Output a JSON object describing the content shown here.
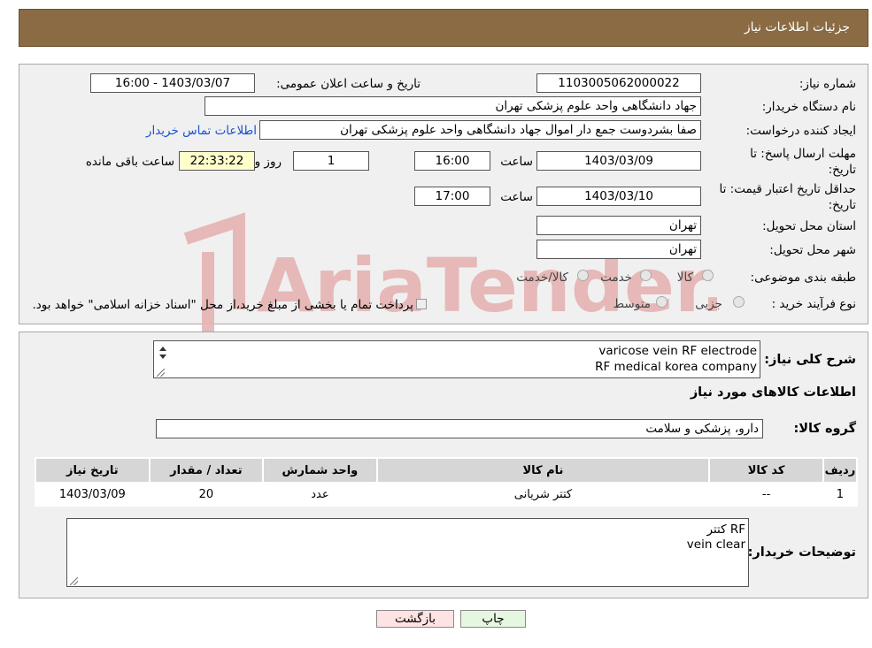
{
  "header": {
    "title": "جزئیات اطلاعات نیاز"
  },
  "details": {
    "need_number_label": "شماره نیاز:",
    "need_number": "1103005062000022",
    "announce_label": "تاریخ و ساعت اعلان عمومی:",
    "announce_value": "1403/03/07 - 16:00",
    "buyer_org_label": "نام دستگاه خریدار:",
    "buyer_org": "جهاد دانشگاهی واحد علوم پزشکی تهران",
    "requester_label": "ایجاد کننده درخواست:",
    "requester": "صفا بشردوست جمع دار اموال  جهاد دانشگاهی واحد علوم پزشکی تهران",
    "contact_link": "اطلاعات تماس خریدار",
    "deadline_label_1": "مهلت ارسال پاسخ: تا",
    "deadline_label_2": "تاریخ:",
    "deadline_date": "1403/03/09",
    "time_label": "ساعت",
    "deadline_time": "16:00",
    "days": "1",
    "days_label": "روز و",
    "remaining": "22:33:22",
    "remaining_label": "ساعت باقی مانده",
    "validity_label_1": "حداقل تاریخ اعتبار قیمت: تا",
    "validity_label_2": "تاریخ:",
    "validity_date": "1403/03/10",
    "validity_time": "17:00",
    "province_label": "استان محل تحویل:",
    "province": "تهران",
    "city_label": "شهر محل تحویل:",
    "city": "تهران",
    "category_label": "طبقه بندی موضوعی:",
    "category_options": [
      "کالا",
      "خدمت",
      "کالا/خدمت"
    ],
    "process_label": "نوع فرآیند خرید :",
    "process_options": [
      "جزیی",
      "متوسط"
    ],
    "process_note": "پرداخت تمام یا بخشی از مبلغ خرید،از محل \"اسناد خزانه اسلامی\" خواهد بود."
  },
  "summary": {
    "label": "شرح کلی نیاز:",
    "lines": [
      "varicose vein RF  electrode",
      "RF medical korea company"
    ]
  },
  "goods_section_title": "اطلاعات کالاهای مورد نیاز",
  "group": {
    "label": "گروه کالا:",
    "value": "دارو، پزشکی و سلامت"
  },
  "table": {
    "headers": [
      "ردیف",
      "کد کالا",
      "نام کالا",
      "واحد شمارش",
      "تعداد / مقدار",
      "تاریخ نیاز"
    ],
    "rows": [
      [
        "1",
        "--",
        "کتتر شریانی",
        "عدد",
        "20",
        "1403/03/09"
      ]
    ]
  },
  "buyer_notes": {
    "label": "توضیحات خریدار:",
    "lines": [
      "کتتر RF",
      "vein clear"
    ]
  },
  "buttons": {
    "print": "چاپ",
    "back": "بازگشت"
  },
  "watermark": {
    "text": "AriaTender.neT"
  },
  "colors": {
    "header_bg": "#8b6b43",
    "link": "#1a4fd6",
    "timer_bg": "#ffffcc",
    "watermark": "#e6b3b3"
  }
}
